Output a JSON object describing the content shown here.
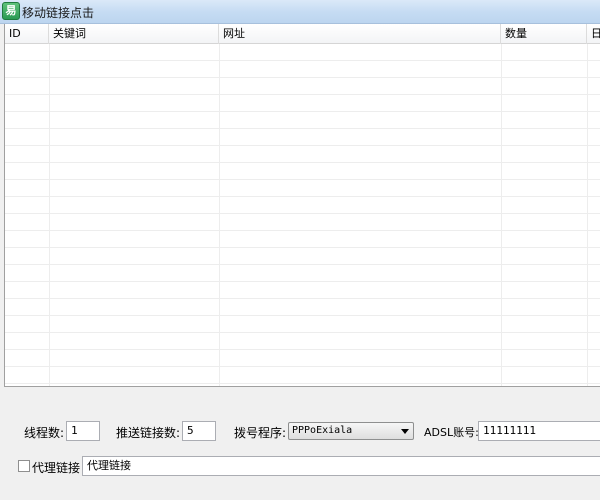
{
  "window": {
    "title": "移动链接点击",
    "icon_glyph": "易"
  },
  "table": {
    "columns": [
      "ID",
      "关键词",
      "网址",
      "数量",
      "日"
    ]
  },
  "form": {
    "threads_label": "线程数:",
    "threads_value": "1",
    "push_label": "推送链接数:",
    "push_value": "5",
    "dialer_label": "拨号程序:",
    "dialer_selected": "PPPoExiala",
    "adsl_label": "ADSL账号:",
    "adsl_value": "11111111",
    "proxy_label": "代理链接",
    "proxy_value": "代理链接"
  }
}
